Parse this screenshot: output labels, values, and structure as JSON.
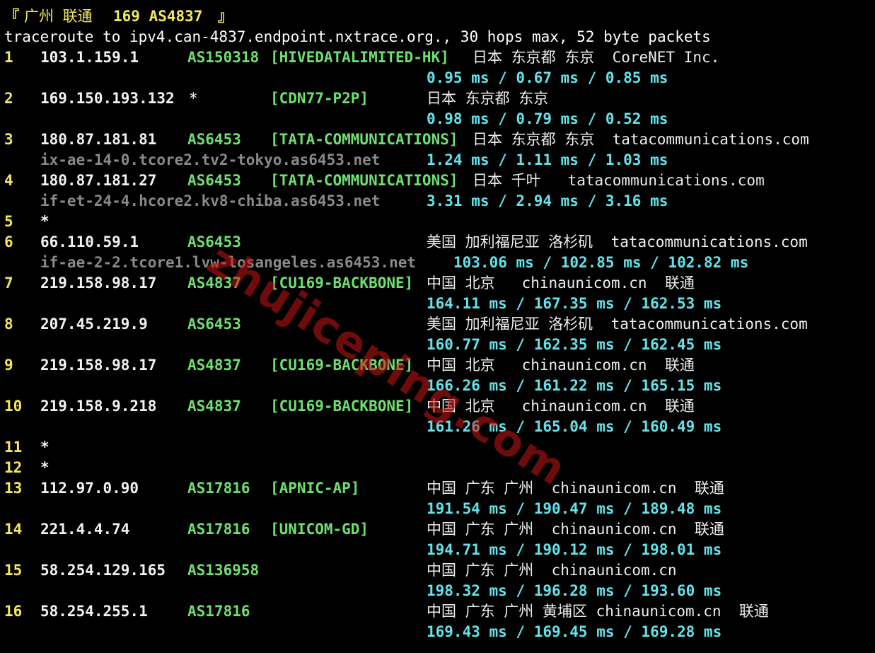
{
  "header": {
    "title_open": "『",
    "title_region": "广州 联通",
    "title_asn": "169 AS4837",
    "title_close": "』"
  },
  "command": "traceroute to ipv4.can-4837.endpoint.nxtrace.org., 30 hops max, 52 byte packets",
  "hops": [
    {
      "num": "1",
      "ip": "103.1.159.1",
      "asn": "AS150318",
      "net": "[HIVEDATALIMITED-HK]",
      "loc": "日本 东京都 东京  CoreNET Inc.",
      "rdns": "",
      "rtt": [
        "0.95 ms",
        "0.67 ms",
        "0.85 ms"
      ]
    },
    {
      "num": "2",
      "ip": "169.150.193.132",
      "asn": "*",
      "net": "[CDN77-P2P]",
      "loc": "日本 东京都 东京",
      "rdns": "",
      "rtt": [
        "0.98 ms",
        "0.79 ms",
        "0.52 ms"
      ]
    },
    {
      "num": "3",
      "ip": "180.87.181.81",
      "asn": "AS6453",
      "net": "[TATA-COMMUNICATIONS]",
      "loc": "日本 东京都 东京  tatacommunications.com",
      "rdns": "ix-ae-14-0.tcore2.tv2-tokyo.as6453.net",
      "rtt": [
        "1.24 ms",
        "1.11 ms",
        "1.03 ms"
      ]
    },
    {
      "num": "4",
      "ip": "180.87.181.27",
      "asn": "AS6453",
      "net": "[TATA-COMMUNICATIONS]",
      "loc": "日本 千叶   tatacommunications.com",
      "rdns": "if-et-24-4.hcore2.kv8-chiba.as6453.net",
      "rtt": [
        "3.31 ms",
        "2.94 ms",
        "3.16 ms"
      ]
    },
    {
      "num": "5",
      "ip": "*",
      "asn": "",
      "net": "",
      "loc": "",
      "rdns": "",
      "rtt": []
    },
    {
      "num": "6",
      "ip": "66.110.59.1",
      "asn": "AS6453",
      "net": "",
      "loc": "美国 加利福尼亚 洛杉矶  tatacommunications.com",
      "rdns": "if-ae-2-2.tcore1.lvw-losangeles.as6453.net",
      "rtt": [
        "103.06 ms",
        "102.85 ms",
        "102.82 ms"
      ]
    },
    {
      "num": "7",
      "ip": "219.158.98.17",
      "asn": "AS4837",
      "net": "[CU169-BACKBONE]",
      "loc": "中国 北京   chinaunicom.cn  联通",
      "rdns": "",
      "rtt": [
        "164.11 ms",
        "167.35 ms",
        "162.53 ms"
      ]
    },
    {
      "num": "8",
      "ip": "207.45.219.9",
      "asn": "AS6453",
      "net": "",
      "loc": "美国 加利福尼亚 洛杉矶  tatacommunications.com",
      "rdns": "",
      "rtt": [
        "160.77 ms",
        "162.35 ms",
        "162.45 ms"
      ]
    },
    {
      "num": "9",
      "ip": "219.158.98.17",
      "asn": "AS4837",
      "net": "[CU169-BACKBONE]",
      "loc": "中国 北京   chinaunicom.cn  联通",
      "rdns": "",
      "rtt": [
        "166.26 ms",
        "161.22 ms",
        "165.15 ms"
      ]
    },
    {
      "num": "10",
      "ip": "219.158.9.218",
      "asn": "AS4837",
      "net": "[CU169-BACKBONE]",
      "loc": "中国 北京   chinaunicom.cn  联通",
      "rdns": "",
      "rtt": [
        "161.26 ms",
        "165.04 ms",
        "160.49 ms"
      ]
    },
    {
      "num": "11",
      "ip": "*",
      "asn": "",
      "net": "",
      "loc": "",
      "rdns": "",
      "rtt": []
    },
    {
      "num": "12",
      "ip": "*",
      "asn": "",
      "net": "",
      "loc": "",
      "rdns": "",
      "rtt": []
    },
    {
      "num": "13",
      "ip": "112.97.0.90",
      "asn": "AS17816",
      "net": "[APNIC-AP]",
      "loc": "中国 广东 广州  chinaunicom.cn  联通",
      "rdns": "",
      "rtt": [
        "191.54 ms",
        "190.47 ms",
        "189.48 ms"
      ]
    },
    {
      "num": "14",
      "ip": "221.4.4.74",
      "asn": "AS17816",
      "net": "[UNICOM-GD]",
      "loc": "中国 广东 广州  chinaunicom.cn  联通",
      "rdns": "",
      "rtt": [
        "194.71 ms",
        "190.12 ms",
        "198.01 ms"
      ]
    },
    {
      "num": "15",
      "ip": "58.254.129.165",
      "asn": "AS136958",
      "net": "",
      "loc": "中国 广东 广州  chinaunicom.cn",
      "rdns": "",
      "rtt": [
        "198.32 ms",
        "196.28 ms",
        "193.60 ms"
      ]
    },
    {
      "num": "16",
      "ip": "58.254.255.1",
      "asn": "AS17816",
      "net": "",
      "loc": "中国 广东 广州 黄埔区 chinaunicom.cn  联通",
      "rdns": "",
      "rtt": [
        "169.43 ms",
        "169.45 ms",
        "169.28 ms"
      ]
    }
  ],
  "watermark": "zhujiceping.com",
  "colors": {
    "background": "#000000",
    "hop_number": "#f3e85b",
    "asn": "#6fe06f",
    "rtt": "#63e3ea",
    "rdns": "#8a8a8a"
  }
}
